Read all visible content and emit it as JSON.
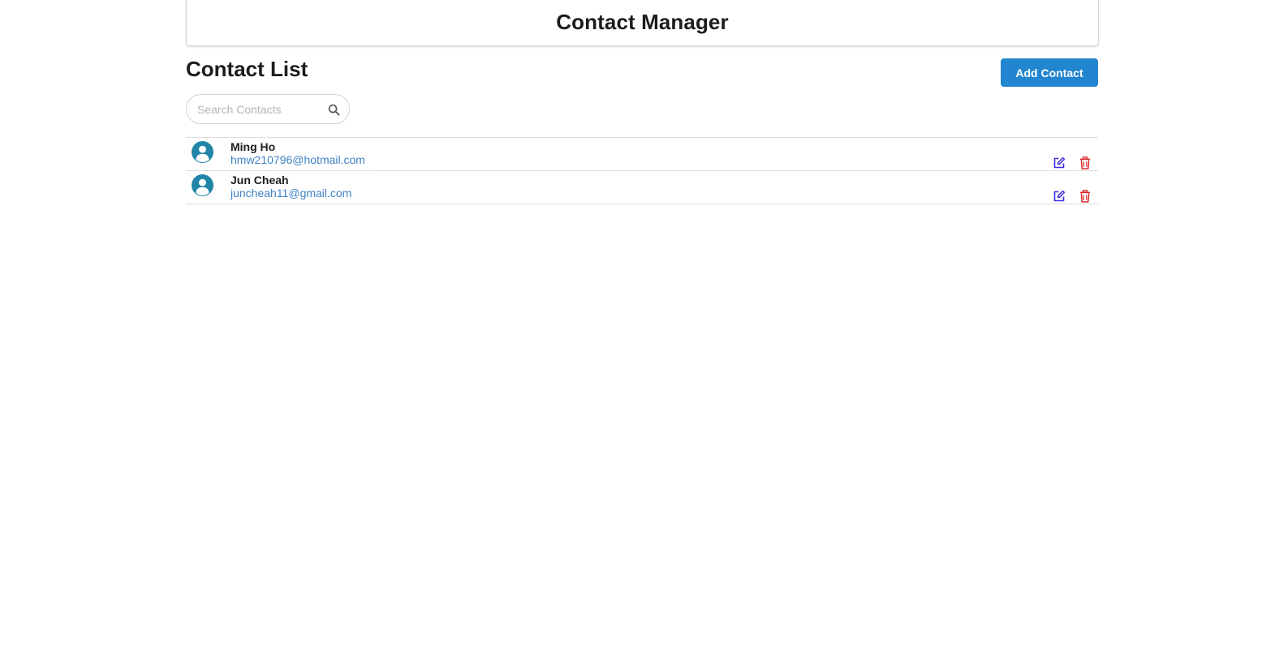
{
  "header": {
    "title": "Contact Manager"
  },
  "main": {
    "title": "Contact List",
    "add_button_label": "Add Contact",
    "search": {
      "placeholder": "Search Contacts",
      "value": "",
      "icon": "search-icon"
    },
    "contacts": [
      {
        "name": "Ming Ho",
        "email": "hmw210796@hotmail.com",
        "avatar": "user-avatar-icon"
      },
      {
        "name": "Jun Cheah",
        "email": "juncheah11@gmail.com",
        "avatar": "user-avatar-icon"
      }
    ],
    "row_icons": [
      "edit-icon",
      "trash-icon"
    ]
  },
  "colors": {
    "primary_button": "#2185d0",
    "email_link": "#4183c4",
    "avatar": "#2185a8",
    "edit_icon": "#3d2fe0",
    "delete_icon": "#db2828"
  }
}
